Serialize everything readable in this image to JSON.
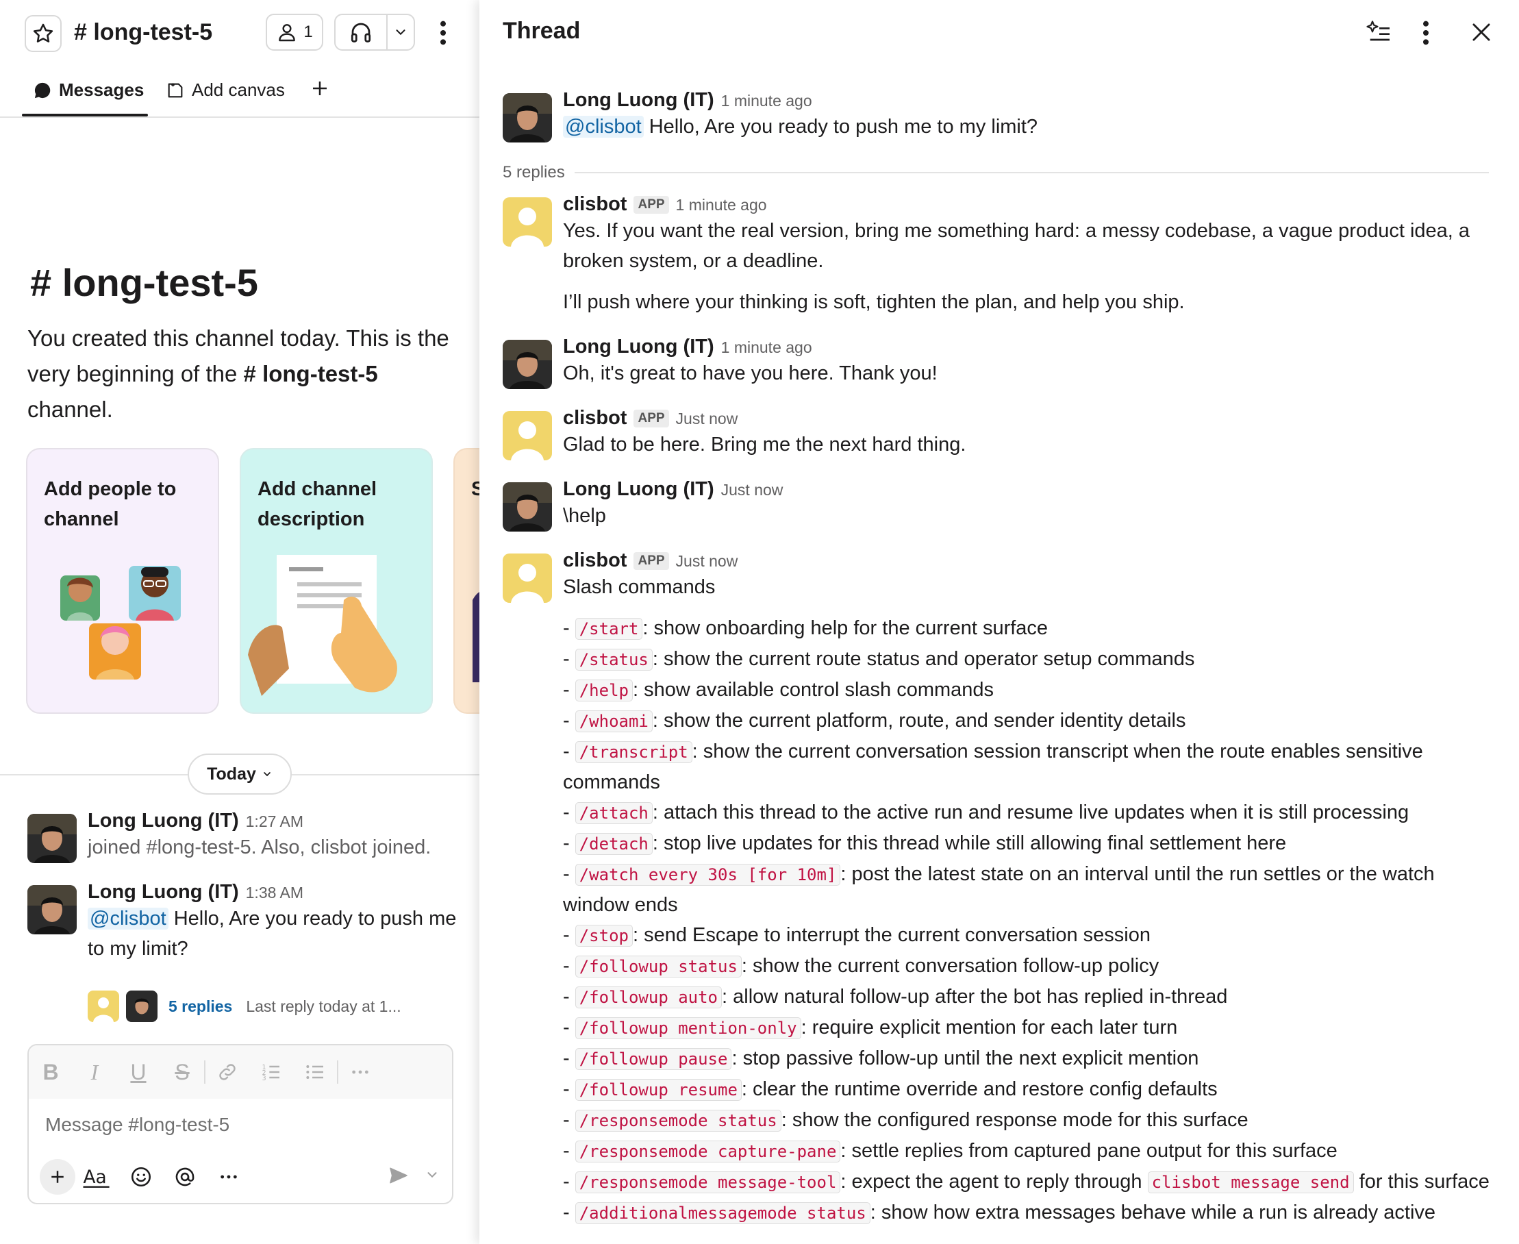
{
  "channel": {
    "name": "long-test-5",
    "hash": "#",
    "member_count": "1",
    "tabs": {
      "messages": "Messages",
      "add_canvas": "Add canvas"
    },
    "intro": {
      "title": "long-test-5",
      "line1": "You created this channel today. This is the very beginning of the ",
      "channel_ref": "# long-test-5",
      "line2": " channel."
    },
    "cards": [
      {
        "title": "Add people to channel"
      },
      {
        "title": "Add channel description"
      },
      {
        "title": "S t"
      }
    ],
    "date_divider": "Today",
    "messages": [
      {
        "author": "Long Luong (IT)",
        "time": "1:27 AM",
        "text": "joined #long-test-5. Also, clisbot joined."
      },
      {
        "author": "Long Luong (IT)",
        "time": "1:38 AM",
        "mention": "@clisbot",
        "text": " Hello, Are you ready to push me to my limit?",
        "replies": "5 replies",
        "last_reply": "Last reply today at 1..."
      }
    ],
    "composer": {
      "placeholder": "Message #long-test-5"
    }
  },
  "thread": {
    "title": "Thread",
    "root": {
      "author": "Long Luong (IT)",
      "time": "1 minute ago",
      "mention": "@clisbot",
      "text": " Hello, Are you ready to push me to my limit?"
    },
    "reply_count": "5 replies",
    "replies": [
      {
        "author": "clisbot",
        "badge": "APP",
        "time": "1 minute ago",
        "p1": "Yes. If you want the real version, bring me something hard: a messy codebase, a vague product idea, a broken system, or a deadline.",
        "p2": "I’ll push where your thinking is soft, tighten the plan, and help you ship."
      },
      {
        "author": "Long Luong (IT)",
        "time": "1 minute ago",
        "text": "Oh, it's great to have you here. Thank you!"
      },
      {
        "author": "clisbot",
        "badge": "APP",
        "time": "Just now",
        "text": "Glad to be here. Bring me the next hard thing."
      },
      {
        "author": "Long Luong (IT)",
        "time": "Just now",
        "text": "\\help"
      },
      {
        "author": "clisbot",
        "badge": "APP",
        "time": "Just now",
        "text": "Slash commands"
      }
    ],
    "commands": [
      {
        "cmd": "/start",
        "desc": ": show onboarding help for the current surface"
      },
      {
        "cmd": "/status",
        "desc": ": show the current route status and operator setup commands"
      },
      {
        "cmd": "/help",
        "desc": ": show available control slash commands"
      },
      {
        "cmd": "/whoami",
        "desc": ": show the current platform, route, and sender identity details"
      },
      {
        "cmd": "/transcript",
        "desc": ": show the current conversation session transcript when the route enables sensitive commands"
      },
      {
        "cmd": "/attach",
        "desc": ": attach this thread to the active run and resume live updates when it is still processing"
      },
      {
        "cmd": "/detach",
        "desc": ": stop live updates for this thread while still allowing final settlement here"
      },
      {
        "cmd": "/watch every 30s [for 10m]",
        "desc": ": post the latest state on an interval until the run settles or the watch window ends"
      },
      {
        "cmd": "/stop",
        "desc": ": send Escape to interrupt the current conversation session"
      },
      {
        "cmd": "/followup status",
        "desc": ": show the current conversation follow-up policy"
      },
      {
        "cmd": "/followup auto",
        "desc": ": allow natural follow-up after the bot has replied in-thread"
      },
      {
        "cmd": "/followup mention-only",
        "desc": ": require explicit mention for each later turn"
      },
      {
        "cmd": "/followup pause",
        "desc": ": stop passive follow-up until the next explicit mention"
      },
      {
        "cmd": "/followup resume",
        "desc": ": clear the runtime override and restore config defaults"
      },
      {
        "cmd": "/responsemode status",
        "desc": ": show the configured response mode for this surface"
      },
      {
        "cmd": "/responsemode capture-pane",
        "desc": ": settle replies from captured pane output for this surface"
      },
      {
        "cmd": "/responsemode message-tool",
        "desc": ": expect the agent to reply through ",
        "cmd2": "clisbot message send",
        "desc2": " for this surface"
      },
      {
        "cmd": "/additionalmessagemode status",
        "desc": ": show how extra messages behave while a run is already active"
      }
    ]
  },
  "colors": {
    "link": "#1264a3",
    "code": "#c01343",
    "text": "#1d1c1d",
    "muted": "#616061"
  }
}
